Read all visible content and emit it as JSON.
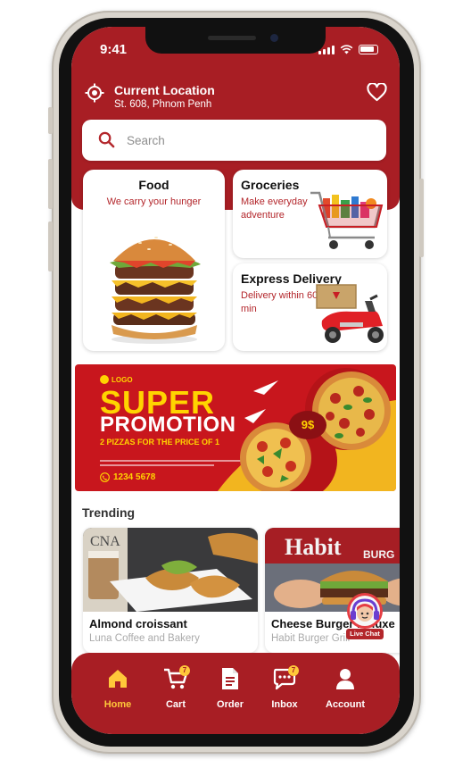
{
  "status_bar": {
    "time": "9:41"
  },
  "location": {
    "title": "Current Location",
    "address": "St. 608,  Phnom Penh"
  },
  "search": {
    "placeholder": "Search"
  },
  "categories": [
    {
      "title": "Food",
      "description": "We carry your hunger"
    },
    {
      "title": "Groceries",
      "description": "Make everyday adventure"
    },
    {
      "title": "Express Delivery",
      "description": "Delivery within 60 min"
    }
  ],
  "promo": {
    "logo": "LOGO",
    "headline_1": "SUPER",
    "headline_2": "PROMOTION",
    "deal": "2 PIZZAS FOR THE PRICE OF 1",
    "phone": "1234 5678",
    "price": "9$"
  },
  "trending": {
    "title": "Trending",
    "items": [
      {
        "name": "Almond croissant",
        "shop": "Luna Coffee and Bakery"
      },
      {
        "name": "Cheese Burger Deluxe",
        "shop": "Habit Burger Grill"
      }
    ]
  },
  "live_chat": {
    "label": "Live Chat"
  },
  "bottom_nav": {
    "items": [
      {
        "label": "Home",
        "active": true
      },
      {
        "label": "Cart",
        "badge": "7"
      },
      {
        "label": "Order"
      },
      {
        "label": "Inbox",
        "badge": "7"
      },
      {
        "label": "Account"
      }
    ]
  },
  "colors": {
    "brand_red": "#a81e24",
    "accent_yellow": "#ffc83a"
  }
}
